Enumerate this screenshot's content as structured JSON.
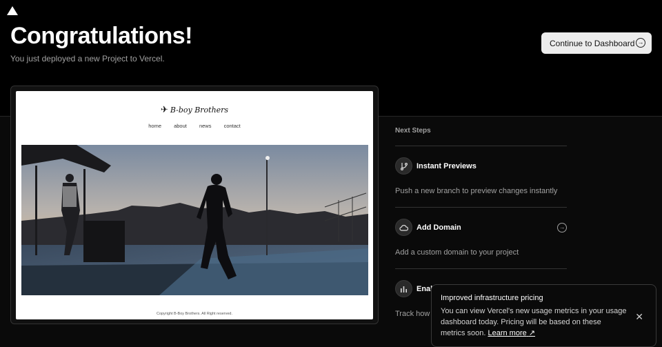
{
  "header": {
    "title": "Congratulations!",
    "subtitle": "You just deployed a new Project to Vercel.",
    "cta_label": "Continue to Dashboard"
  },
  "preview": {
    "site_logo": "B-boy Brothers",
    "nav": [
      "home",
      "about",
      "news",
      "contact"
    ],
    "footer": "Copyright B-Boy Brothers. All Right reserved."
  },
  "next_steps": {
    "title": "Next Steps",
    "items": [
      {
        "label": "Instant Previews",
        "description": "Push a new branch to preview changes instantly",
        "icon": "git-branch-icon"
      },
      {
        "label": "Add Domain",
        "description": "Add a custom domain to your project",
        "icon": "cloud-icon"
      },
      {
        "label": "Enal",
        "description": "Track how",
        "icon": "bar-chart-icon"
      }
    ]
  },
  "toast": {
    "title": "Improved infrastructure pricing",
    "body": "You can view Vercel's new usage metrics in your usage dashboard today. Pricing will be based on these metrics soon.",
    "link": "Learn more"
  },
  "colors": {
    "background": "#000000",
    "cta_bg": "#ededed",
    "muted": "#a1a1a1"
  }
}
